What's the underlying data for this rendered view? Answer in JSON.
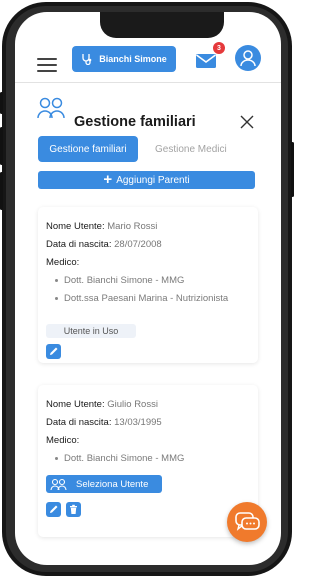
{
  "header": {
    "user_name": "Bianchi Simone",
    "mail_badge_count": "3",
    "colors": {
      "primary": "#3a8be0",
      "badge": "#e5393b",
      "fab": "#f07a2c"
    }
  },
  "page": {
    "title": "Gestione familiari",
    "tabs": [
      {
        "label": "Gestione familiari",
        "active": true
      },
      {
        "label": "Gestione Medici",
        "active": false
      }
    ],
    "add_button_label": "Aggiungi Parenti"
  },
  "cards": [
    {
      "name_label": "Nome Utente:",
      "name_value": "Mario Rossi",
      "birth_label": "Data di nascita:",
      "birth_value": "28/07/2008",
      "medico_label": "Medico:",
      "doctors": [
        "Dott. Bianchi Simone - MMG",
        "Dott.ssa Paesani Marina - Nutrizionista"
      ],
      "status_tag": "Utente in Uso"
    },
    {
      "name_label": "Nome Utente:",
      "name_value": "Giulio Rossi",
      "birth_label": "Data di nascita:",
      "birth_value": "13/03/1995",
      "medico_label": "Medico:",
      "doctors": [
        "Dott. Bianchi Simone - MMG"
      ],
      "select_button_label": "Seleziona Utente"
    }
  ]
}
